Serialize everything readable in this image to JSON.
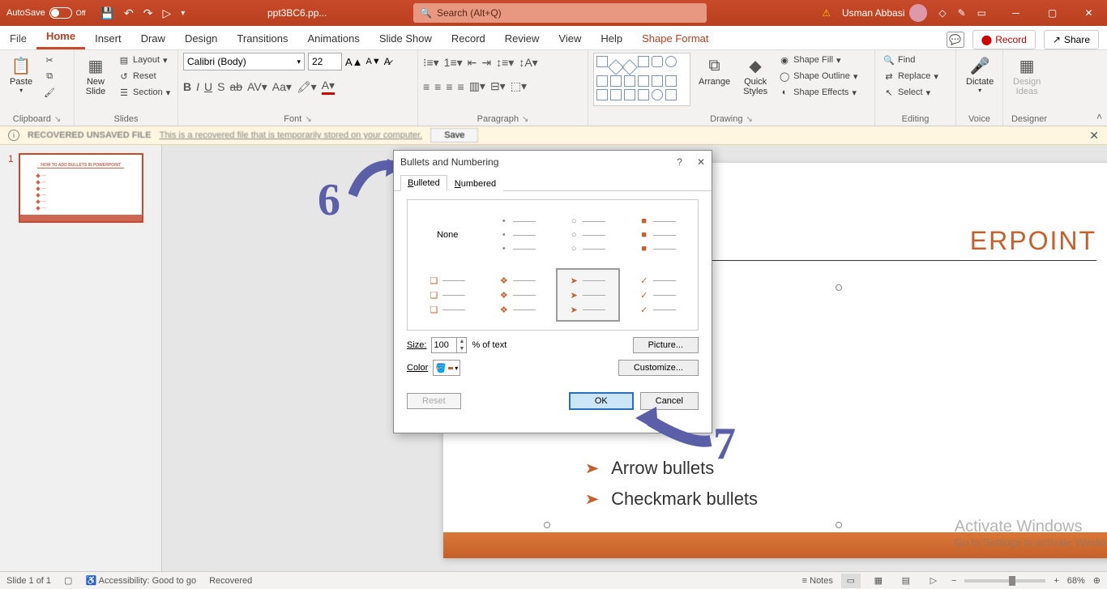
{
  "titlebar": {
    "autosave": "AutoSave",
    "autosave_state": "Off",
    "filename": "ppt3BC6.pp...",
    "search_placeholder": "Search (Alt+Q)",
    "username": "Usman Abbasi"
  },
  "tabs": {
    "file": "File",
    "home": "Home",
    "insert": "Insert",
    "draw": "Draw",
    "design": "Design",
    "transitions": "Transitions",
    "animations": "Animations",
    "slideshow": "Slide Show",
    "record": "Record",
    "review": "Review",
    "view": "View",
    "help": "Help",
    "shapeformat": "Shape Format",
    "recordbtn": "Record",
    "share": "Share"
  },
  "ribbon": {
    "clipboard": {
      "paste": "Paste",
      "label": "Clipboard"
    },
    "slides": {
      "newslide": "New\nSlide",
      "layout": "Layout",
      "reset": "Reset",
      "section": "Section",
      "label": "Slides"
    },
    "font": {
      "name": "Calibri (Body)",
      "size": "22",
      "label": "Font"
    },
    "paragraph": {
      "label": "Paragraph"
    },
    "drawing": {
      "arrange": "Arrange",
      "quick": "Quick\nStyles",
      "shapefill": "Shape Fill",
      "shapeoutline": "Shape Outline",
      "shapeeffects": "Shape Effects",
      "label": "Drawing"
    },
    "editing": {
      "find": "Find",
      "replace": "Replace",
      "select": "Select",
      "label": "Editing"
    },
    "voice": {
      "dictate": "Dictate",
      "label": "Voice"
    },
    "designer": {
      "ideas": "Design\nIdeas",
      "label": "Designer"
    }
  },
  "msgbar": {
    "bold": "RECOVERED UNSAVED FILE",
    "text": "This is a recovered file that is temporarily stored on your computer.",
    "save": "Save"
  },
  "thumb": {
    "num": "1"
  },
  "slide": {
    "title_fragment": "ERPOINT",
    "items": [
      "Arrow bullets",
      "Checkmark bullets"
    ]
  },
  "activate": {
    "h": "Activate Windows",
    "s": "Go to Settings to activate Windows."
  },
  "dialog": {
    "title": "Bullets and Numbering",
    "tab_bulleted": "Bulleted",
    "tab_numbered": "Numbered",
    "none": "None",
    "size": "Size:",
    "size_val": "100",
    "pct": "% of text",
    "color": "Color",
    "picture": "Picture...",
    "customize": "Customize...",
    "reset": "Reset",
    "ok": "OK",
    "cancel": "Cancel"
  },
  "anno": {
    "six": "6",
    "seven": "7"
  },
  "status": {
    "slide": "Slide 1 of 1",
    "access": "Accessibility: Good to go",
    "recovered": "Recovered",
    "notes": "Notes",
    "zoom": "68%"
  },
  "chart_data": null
}
